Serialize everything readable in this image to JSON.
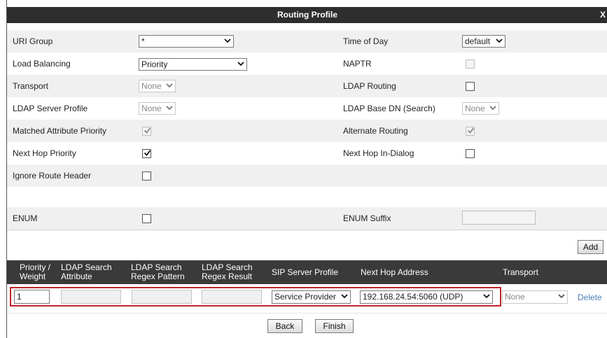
{
  "dialog": {
    "title": "Routing Profile",
    "close_label": "X"
  },
  "fields": {
    "uri_group": {
      "label": "URI Group",
      "value": "*"
    },
    "time_of_day": {
      "label": "Time of Day",
      "value": "default"
    },
    "load_balancing": {
      "label": "Load Balancing",
      "value": "Priority"
    },
    "naptr": {
      "label": "NAPTR"
    },
    "transport": {
      "label": "Transport",
      "value": "None"
    },
    "ldap_routing": {
      "label": "LDAP Routing"
    },
    "ldap_server_profile": {
      "label": "LDAP Server Profile",
      "value": "None"
    },
    "ldap_base_dn": {
      "label": "LDAP Base DN (Search)",
      "value": "None"
    },
    "matched_attribute_priority": {
      "label": "Matched Attribute Priority"
    },
    "alternate_routing": {
      "label": "Alternate Routing"
    },
    "next_hop_priority": {
      "label": "Next Hop Priority"
    },
    "next_hop_in_dialog": {
      "label": "Next Hop In-Dialog"
    },
    "ignore_route_header": {
      "label": "Ignore Route Header"
    },
    "enum": {
      "label": "ENUM"
    },
    "enum_suffix": {
      "label": "ENUM Suffix",
      "value": ""
    }
  },
  "add_button": "Add",
  "table": {
    "headers": {
      "priority_line1": "Priority /",
      "priority_line2": "Weight",
      "ldap_attr_line1": "LDAP Search",
      "ldap_attr_line2": "Attribute",
      "ldap_regex_pattern_line1": "LDAP Search",
      "ldap_regex_pattern_line2": "Regex Pattern",
      "ldap_regex_result_line1": "LDAP Search",
      "ldap_regex_result_line2": "Regex Result",
      "sip_server_profile": "SIP Server Profile",
      "next_hop_address": "Next Hop Address",
      "transport": "Transport"
    },
    "row": {
      "priority": "1",
      "sip_server_profile": "Service Provider",
      "next_hop_address": "192.168.24.54:5060 (UDP)",
      "transport": "None",
      "delete_label": "Delete"
    }
  },
  "footer": {
    "back_label": "Back",
    "finish_label": "Finish"
  },
  "colors": {
    "title_bar": "#2e2e2e",
    "highlight_border": "#c0242a",
    "link": "#4a7fb5"
  }
}
